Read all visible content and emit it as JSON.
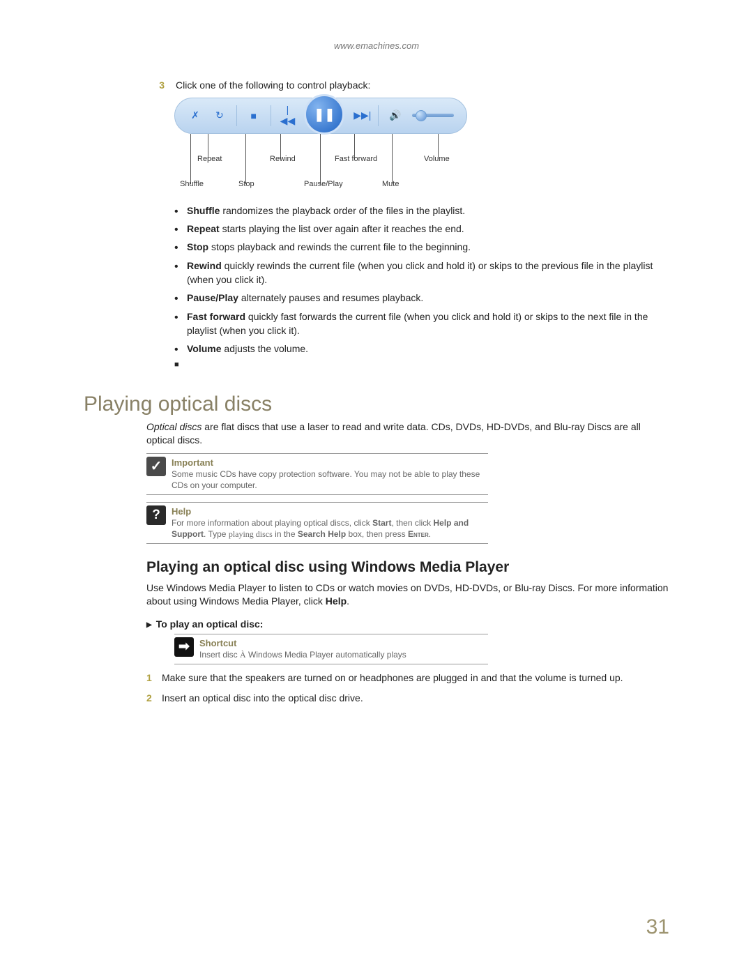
{
  "header_url": "www.emachines.com",
  "step3_num": "3",
  "step3_text": "Click one of the following to control playback:",
  "labels": {
    "shuffle": "Shuffle",
    "repeat": "Repeat",
    "stop": "Stop",
    "rewind": "Rewind",
    "pauseplay": "Pause/Play",
    "fastforward": "Fast forward",
    "mute": "Mute",
    "volume": "Volume"
  },
  "bullets": {
    "b1_bold": "Shuffle",
    "b1_rest": " randomizes the playback order of the files in the playlist.",
    "b2_bold": "Repeat",
    "b2_rest": " starts playing the list over again after it reaches the end.",
    "b3_bold": "Stop",
    "b3_rest": " stops playback and rewinds the current file to the beginning.",
    "b4_bold": "Rewind",
    "b4_rest": " quickly rewinds the current file (when you click and hold it) or skips to the previous file in the playlist (when you click it).",
    "b5_bold": "Pause/Play",
    "b5_rest": " alternately pauses and resumes playback.",
    "b6_bold": "Fast forward",
    "b6_rest": " quickly fast forwards the current file (when you click and hold it) or skips to the next file in the playlist (when you click it).",
    "b7_bold": "Volume",
    "b7_rest": " adjusts the volume."
  },
  "section_heading": "Playing optical discs",
  "section_para_i": "Optical discs",
  "section_para_rest": " are flat discs that use a laser to read and write data. CDs, DVDs, HD-DVDs, and Blu-ray Discs are all optical discs.",
  "important_title": "Important",
  "important_text": "Some music CDs have copy protection software. You may not be able to play these CDs on your computer.",
  "help_title": "Help",
  "help_text_pre": "For more information about playing optical discs, click ",
  "help_start": "Start",
  "help_text_mid": ", then click ",
  "help_hs": "Help and Support",
  "help_text_post": ". Type ",
  "help_term": "playing discs",
  "help_in": " in the ",
  "help_box": "Search Help",
  "help_end": " box, then press ",
  "help_enter": "Enter",
  "help_dot": ".",
  "subsection_heading": "Playing an optical disc using Windows Media Player",
  "subsection_para_pre": "Use Windows Media Player to listen to CDs or watch movies on DVDs, HD-DVDs, or Blu-ray Discs. For more information about using Windows Media Player, click ",
  "subsection_para_bold": "Help",
  "subsection_para_post": ".",
  "proc_head": "To play an optical disc:",
  "shortcut_title": "Shortcut",
  "shortcut_arrow": "À",
  "shortcut_text_pre": "Insert disc ",
  "shortcut_text_post": " Windows Media Player automatically plays",
  "proc_step1_num": "1",
  "proc_step1_text": "Make sure that the speakers are turned on or headphones are plugged in and that the volume is turned up.",
  "proc_step2_num": "2",
  "proc_step2_text": "Insert an optical disc into the optical disc drive.",
  "page_number": "31"
}
